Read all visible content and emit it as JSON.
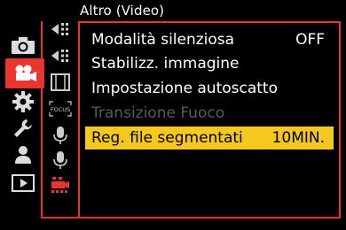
{
  "header": {
    "title": "Altro (Video)"
  },
  "main_tabs": [
    {
      "icon": "camera-icon",
      "active": false
    },
    {
      "icon": "video-camera-icon",
      "active": true
    },
    {
      "icon": "gear-icon",
      "active": false
    },
    {
      "icon": "wrench-icon",
      "active": false
    },
    {
      "icon": "person-icon",
      "active": false
    },
    {
      "icon": "playback-icon",
      "active": false
    }
  ],
  "sub_tabs": [
    {
      "icon": "focus-direction-icon"
    },
    {
      "icon": "focus-direction-icon-2"
    },
    {
      "icon": "film-strip-icon"
    },
    {
      "icon": "focus-badge-icon",
      "label": "FOCUS"
    },
    {
      "icon": "microphone-icon"
    },
    {
      "icon": "microphone-icon-2"
    },
    {
      "icon": "video-camera-sub-icon"
    }
  ],
  "menu": {
    "items": [
      {
        "label": "Modalità silenziosa",
        "value": "OFF",
        "state": "normal"
      },
      {
        "label": "Stabilizz. immagine",
        "value": "",
        "state": "normal"
      },
      {
        "label": "Impostazione autoscatto",
        "value": "",
        "state": "normal"
      },
      {
        "label": "Transizione Fuoco",
        "value": "",
        "state": "disabled"
      },
      {
        "label": "Reg. file segmentati",
        "value": "10MIN.",
        "state": "selected"
      }
    ]
  },
  "colors": {
    "accent": "#e8352e",
    "highlight": "#f4c81e",
    "disabled": "#5a5a5a",
    "background": "#000000"
  }
}
